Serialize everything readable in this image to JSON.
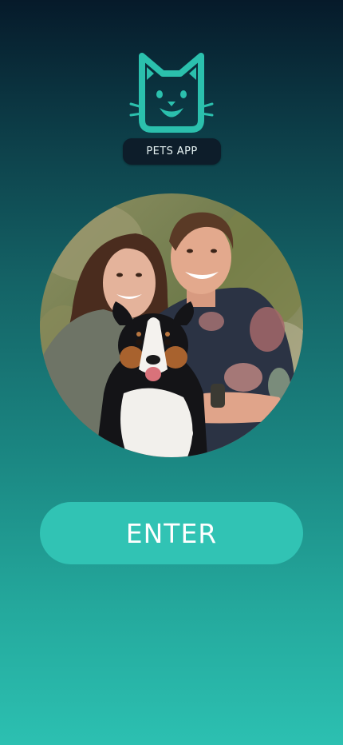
{
  "app": {
    "name": "PETS APP",
    "logo_icon": "cat-face-icon"
  },
  "hero": {
    "image": "couple-with-dog-photo"
  },
  "actions": {
    "enter_label": "ENTER"
  },
  "colors": {
    "accent": "#31c3b4",
    "logo": "#2bc0ad",
    "badge_bg": "#0d1d2a",
    "background_top": "#061a2a",
    "background_bottom": "#2cc0b1"
  }
}
